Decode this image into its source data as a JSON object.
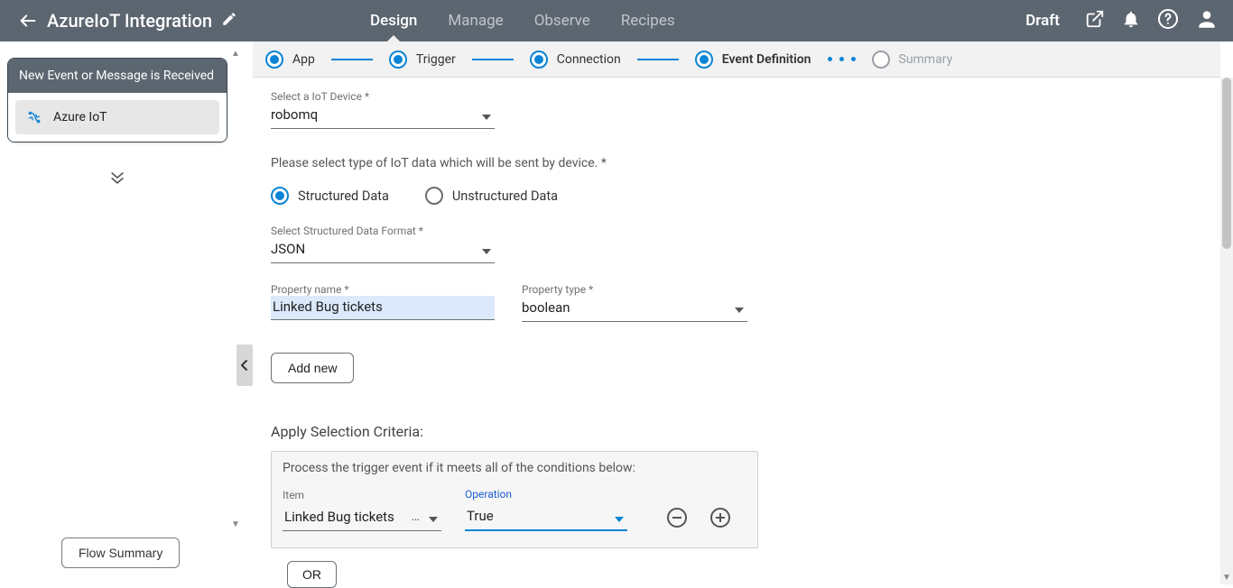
{
  "header": {
    "title": "AzureIoT Integration",
    "status": "Draft",
    "nav": {
      "design": "Design",
      "manage": "Manage",
      "observe": "Observe",
      "recipes": "Recipes",
      "active": "design"
    }
  },
  "wizard": {
    "app": "App",
    "trigger": "Trigger",
    "connection": "Connection",
    "event_def": "Event Definition",
    "summary": "Summary"
  },
  "sidebar": {
    "card_title": "New Event or Message is Received",
    "item_label": "Azure IoT",
    "flow_summary_btn": "Flow Summary"
  },
  "form": {
    "device_label": "Select a IoT Device *",
    "device_value": "robomq",
    "data_type_hint": "Please select type of IoT data which will be sent by device. *",
    "radio_structured": "Structured Data",
    "radio_unstructured": "Unstructured Data",
    "format_label": "Select Structured Data Format *",
    "format_value": "JSON",
    "prop_name_label": "Property name *",
    "prop_name_value": "Linked Bug tickets",
    "prop_type_label": "Property type *",
    "prop_type_value": "boolean",
    "add_new_btn": "Add new",
    "criteria_title": "Apply Selection Criteria:",
    "criteria_hint": "Process the trigger event if it meets all of the conditions below:",
    "criteria_item_label": "Item",
    "criteria_item_value": "Linked Bug tickets",
    "criteria_op_label": "Operation",
    "criteria_op_value": "True",
    "or_btn": "OR"
  }
}
